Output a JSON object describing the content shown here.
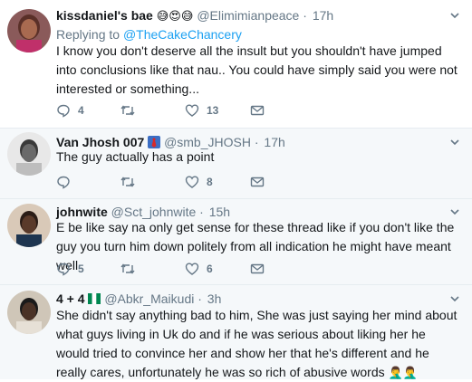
{
  "tweets": [
    {
      "display_name": "kissdaniel's bae",
      "handle": "@Elimimianpeace",
      "dot": "·",
      "time": "17h",
      "replying_prefix": "Replying to",
      "replying_to": "@TheCakeChancery",
      "text": "I know you don't deserve all the insult but you shouldn't have jumped into conclusions like that nau.. You could have simply said you were not interested or something...",
      "replies": "4",
      "retweets": "",
      "likes": "13"
    },
    {
      "display_name": "Van Jhosh 007",
      "handle": "@smb_JHOSH",
      "dot": "·",
      "time": "17h",
      "text": "The guy actually has a point",
      "replies": "",
      "retweets": "",
      "likes": "8"
    },
    {
      "display_name": "johnwite",
      "handle": "@Sct_johnwite",
      "dot": "·",
      "time": "15h",
      "text": "E be like say na only get sense for these thread like if you don't like the guy you turn him down politely from all indication he might have meant well",
      "replies": "5",
      "retweets": "",
      "likes": "6"
    },
    {
      "display_name": "4 + 4",
      "handle": "@Abkr_Maikudi",
      "dot": "·",
      "time": "3h",
      "text": "She didn't say anything bad to him, She was just saying her mind about what guys living in Uk do and if he was serious about liking her he would tried to convince her and show her that he's different and he really cares, unfortunately he was so rich of abusive words",
      "trailing_emoji": "🤦‍♂️🤦‍♂️"
    }
  ],
  "colors": {
    "link": "#1da1f2",
    "secondary_text": "#657786",
    "divider": "#e6ecf0",
    "reply_bg": "#f5f8fa",
    "nigeria_green": "#008751"
  }
}
